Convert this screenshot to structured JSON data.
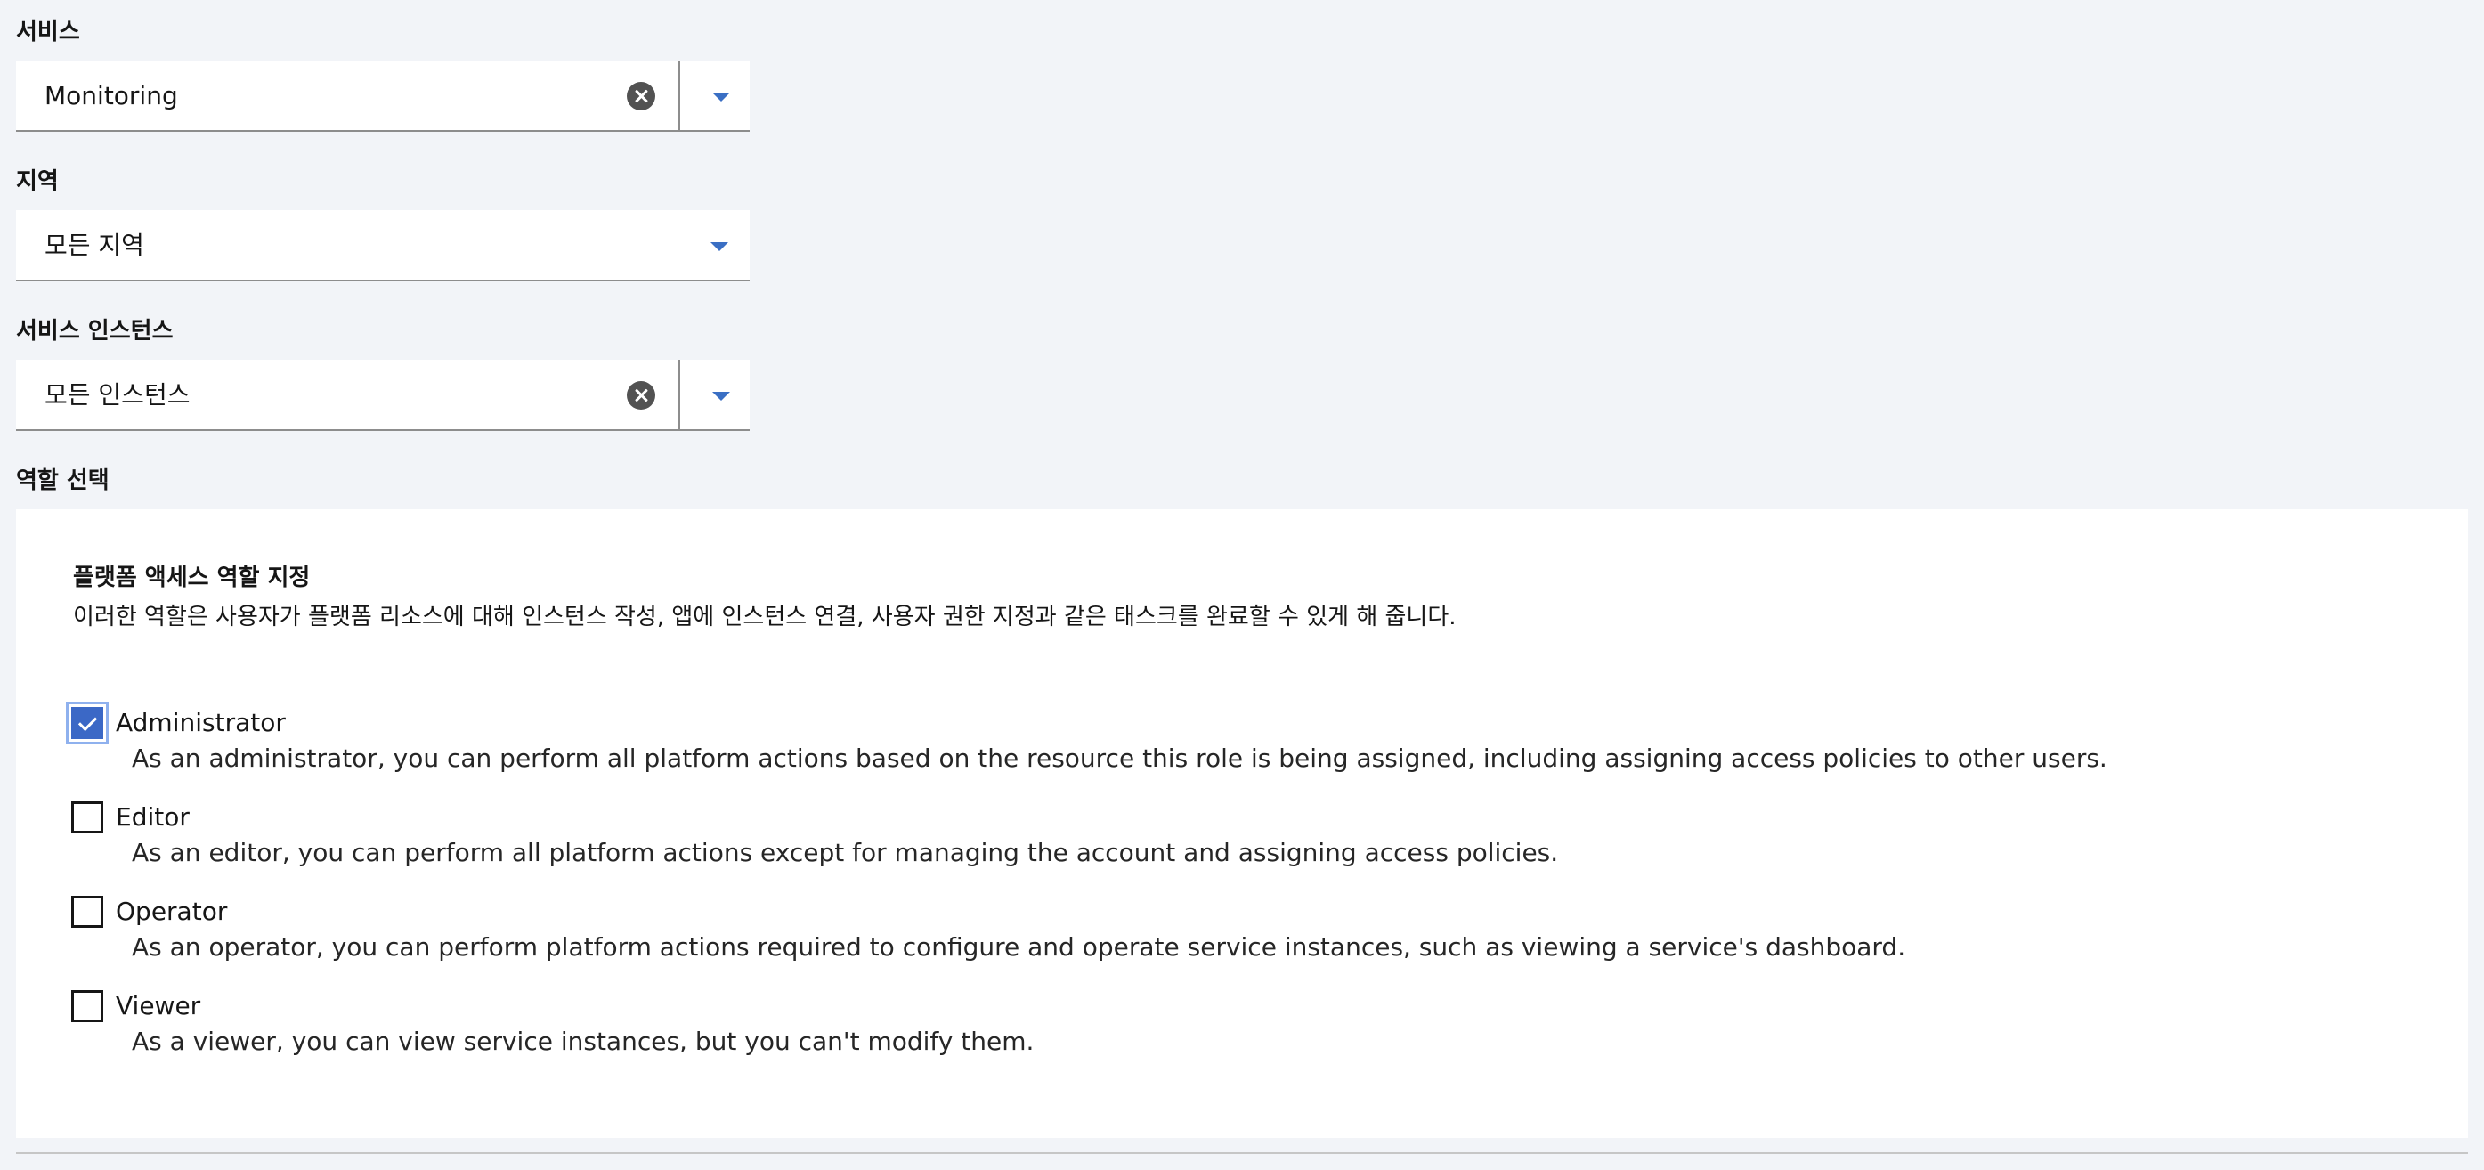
{
  "service": {
    "label": "서비스",
    "value": "Monitoring"
  },
  "region": {
    "label": "지역",
    "value": "모든 지역"
  },
  "service_instance": {
    "label": "서비스 인스턴스",
    "value": "모든 인스턴스"
  },
  "roles_section": {
    "label": "역할 선택",
    "panel_title": "플랫폼 액세스 역할 지정",
    "panel_description": "이러한 역할은 사용자가 플랫폼 리소스에 대해 인스턴스 작성, 앱에 인스턴스 연결, 사용자 권한 지정과 같은 태스크를 완료할 수 있게 해 줍니다.",
    "roles": [
      {
        "name": "Administrator",
        "description": "As an administrator, you can perform all platform actions based on the resource this role is being assigned, including assigning access policies to other users.",
        "checked": true
      },
      {
        "name": "Editor",
        "description": "As an editor, you can perform all platform actions except for managing the account and assigning access policies.",
        "checked": false
      },
      {
        "name": "Operator",
        "description": "As an operator, you can perform platform actions required to configure and operate service instances, such as viewing a service's dashboard.",
        "checked": false
      },
      {
        "name": "Viewer",
        "description": "As a viewer, you can view service instances, but you can't modify them.",
        "checked": false
      }
    ]
  },
  "icons": {
    "clear": "clear-circle-icon",
    "dropdown": "caret-down-icon",
    "check": "checkmark-icon"
  },
  "colors": {
    "accent": "#3b68c6",
    "caret": "#3a6fc4",
    "page_background": "#f2f4f8",
    "panel_background": "#ffffff"
  }
}
